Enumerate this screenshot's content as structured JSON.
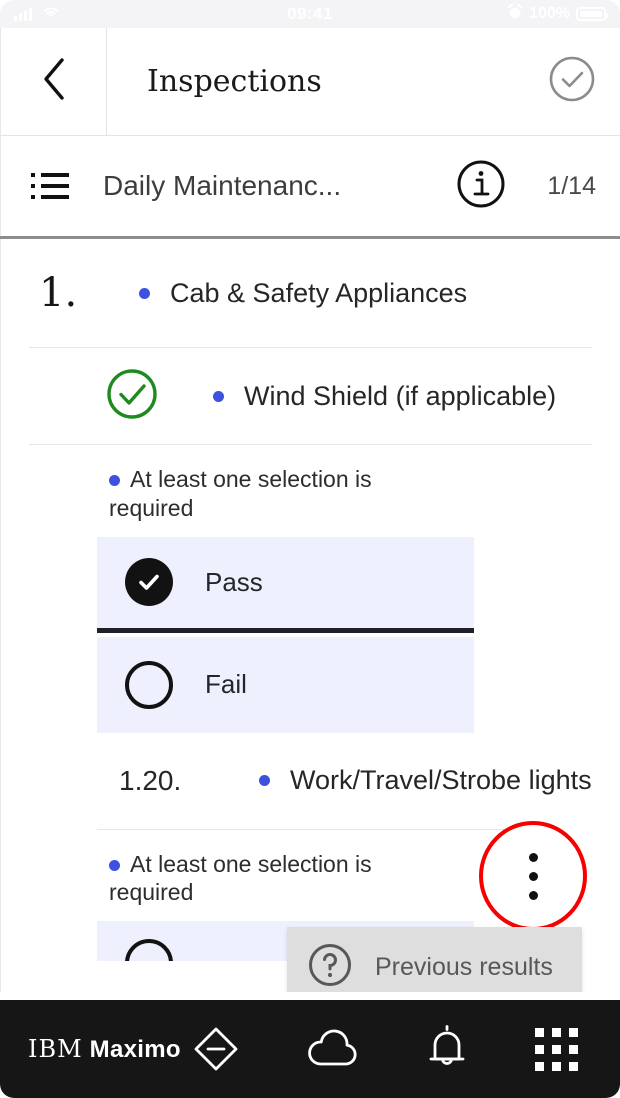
{
  "status_bar": {
    "time": "09:41",
    "battery_percent": "100%",
    "signal_icon": "signal-bars-icon",
    "wifi_icon": "wifi-icon",
    "alarm_icon": "alarm-clock-icon",
    "battery_icon": "battery-icon"
  },
  "header": {
    "back_icon": "chevron-left-icon",
    "title": "Inspections",
    "action_icon": "check-circle-icon"
  },
  "subheader": {
    "list_icon": "list-icon",
    "title": "Daily Maintenanc...",
    "info_icon": "info-circle-icon",
    "counter": "1/14"
  },
  "section": {
    "number": "1.",
    "label": "Cab & Safety Appliances"
  },
  "tasks": [
    {
      "number": "",
      "status_icon": "green-check-circle-icon",
      "label": "Wind Shield (if applicable)",
      "required_message": "At least one selection is required",
      "options": [
        {
          "label": "Pass",
          "selected": true
        },
        {
          "label": "Fail",
          "selected": false
        }
      ]
    },
    {
      "number": "1.20.",
      "label": "Work/Travel/Strobe lights",
      "required_message": "At least one selection is required",
      "options": [
        {
          "label": "",
          "selected": false
        }
      ]
    }
  ],
  "overflow_menu": {
    "icon": "overflow-menu-vertical-icon",
    "highlight_color": "#f60000"
  },
  "popup": {
    "icon": "help-circle-icon",
    "label": "Previous results"
  },
  "bottom_bar": {
    "brand_prefix": "IBM",
    "brand_name": "Maximo",
    "icons": [
      "diamond-minus-icon",
      "cloud-icon",
      "notification-bell-icon",
      "app-switcher-icon"
    ]
  },
  "colors": {
    "accent_blue": "#3d50e0",
    "option_bg": "#eef1fd",
    "success_green": "#1f8a1f",
    "annotation_red": "#f60000",
    "bottom_bar_bg": "#161616"
  }
}
